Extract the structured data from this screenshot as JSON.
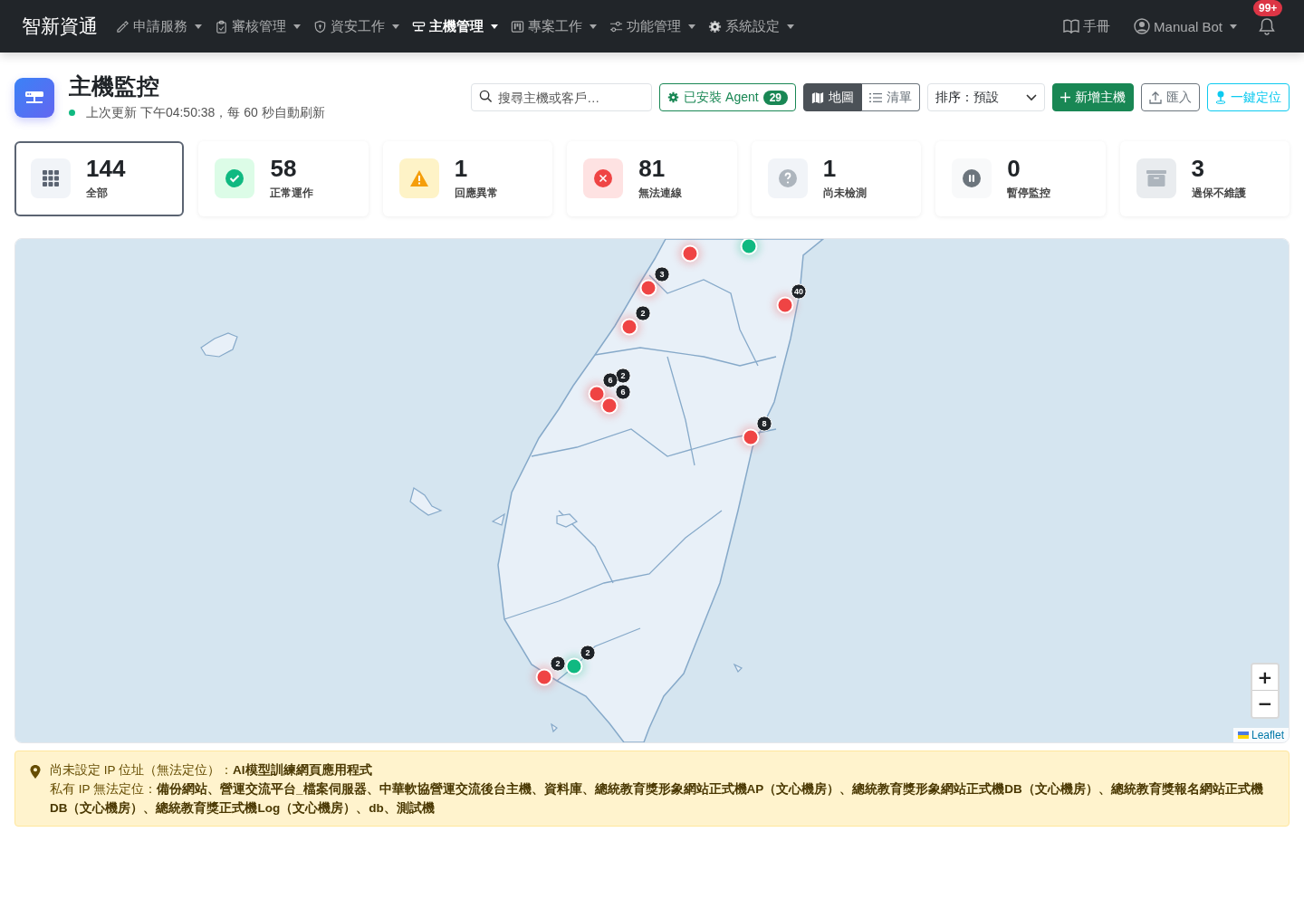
{
  "nav": {
    "brand": "智新資通",
    "items": [
      {
        "label": "申請服務",
        "kind": "edit",
        "selected": false
      },
      {
        "label": "審核管理",
        "kind": "clipboard",
        "selected": false
      },
      {
        "label": "資安工作",
        "kind": "shield",
        "selected": false
      },
      {
        "label": "主機管理",
        "kind": "server",
        "selected": true
      },
      {
        "label": "專案工作",
        "kind": "kanban",
        "selected": false
      },
      {
        "label": "功能管理",
        "kind": "sliders",
        "selected": false
      },
      {
        "label": "系統設定",
        "kind": "gear",
        "selected": false
      }
    ],
    "manual": "手冊",
    "user": "Manual Bot",
    "notifications": "99+"
  },
  "header": {
    "title": "主機監控",
    "status": "上次更新 下午04:50:38，每 60 秒自動刷新",
    "search": {
      "placeholder": "搜尋主機或客戶…"
    },
    "agent": {
      "label": "已安裝 Agent",
      "count": "29"
    },
    "view_toggle": [
      {
        "label": "地圖",
        "kind": "map",
        "selected": true
      },
      {
        "label": "清單",
        "kind": "list",
        "selected": false
      }
    ],
    "sort": "排序：預設",
    "add": "新增主機",
    "import": "匯入",
    "locate": "一鍵定位"
  },
  "stats": [
    {
      "count": "144",
      "label": "全部",
      "kind": "all",
      "selected": true
    },
    {
      "count": "58",
      "label": "正常運作",
      "kind": "ok",
      "selected": false
    },
    {
      "count": "1",
      "label": "回應異常",
      "kind": "warn",
      "selected": false
    },
    {
      "count": "81",
      "label": "無法連線",
      "kind": "down",
      "selected": false
    },
    {
      "count": "1",
      "label": "尚未檢測",
      "kind": "unknown",
      "selected": false
    },
    {
      "count": "0",
      "label": "暫停監控",
      "kind": "paused",
      "selected": false
    },
    {
      "count": "3",
      "label": "過保不維護",
      "kind": "eol",
      "selected": false
    }
  ],
  "map": {
    "markers": [
      {
        "color": "#ef4444"
      },
      {
        "color": "#10b981"
      },
      {
        "color": "#ef4444",
        "count": "3"
      },
      {
        "color": "#ef4444",
        "count": "40"
      },
      {
        "color": "#ef4444",
        "count": "2"
      },
      {
        "count": "2"
      },
      {
        "color": "#ef4444",
        "count": "6"
      },
      {
        "color": "#ef4444",
        "count": "6"
      },
      {
        "color": "#ef4444",
        "count": "8"
      },
      {
        "color": "#10b981",
        "count": "2"
      },
      {
        "color": "#ef4444",
        "count": "2"
      }
    ],
    "zoom_in": "+",
    "zoom_out": "−",
    "attribution": "Leaflet"
  },
  "note": {
    "lines": [
      "尚未設定 IP 位址（無法定位）：**AI模型訓練網頁應用程式**",
      "私有 IP 無法定位：**備份網站、營運交流平台_檔案伺服器、中華軟協營運交流後台主機、資料庫、總統教育獎形象網站正式機AP（文心機房）、總統教育獎形象網站正式機DB（文心機房）、總統教育獎報名網站正式機DB（文心機房）、總統教育獎正式機Log（文心機房）、db、測試機**"
    ]
  }
}
